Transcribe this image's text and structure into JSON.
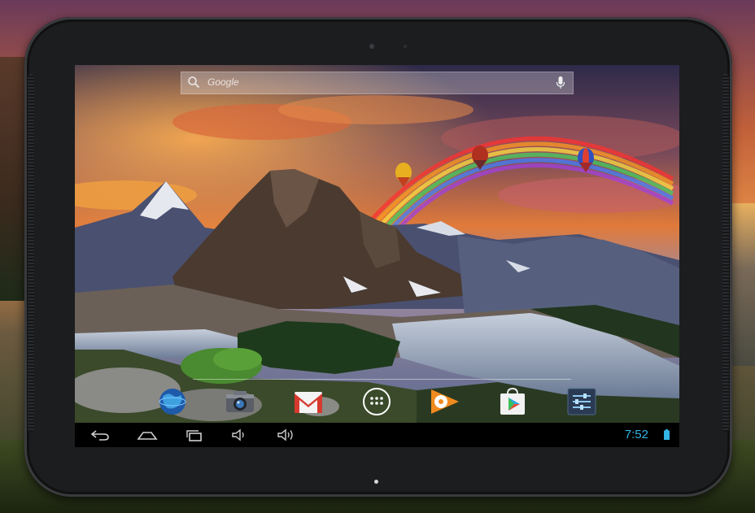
{
  "search": {
    "placeholder": "Google",
    "search_icon": "search-icon",
    "mic_icon": "mic-icon"
  },
  "dock": {
    "items": [
      {
        "icon": "browser-globe-icon"
      },
      {
        "icon": "camera-icon"
      },
      {
        "icon": "gmail-icon"
      },
      {
        "icon": "app-drawer-icon"
      },
      {
        "icon": "play-music-icon"
      },
      {
        "icon": "play-store-icon"
      },
      {
        "icon": "settings-icon"
      }
    ]
  },
  "navigation": {
    "buttons": [
      "back-icon",
      "home-icon",
      "recents-icon",
      "volume-down-icon",
      "volume-up-icon"
    ]
  },
  "status": {
    "time": "7:52",
    "battery_icon": "battery-icon",
    "accent": "#33b5e5"
  }
}
